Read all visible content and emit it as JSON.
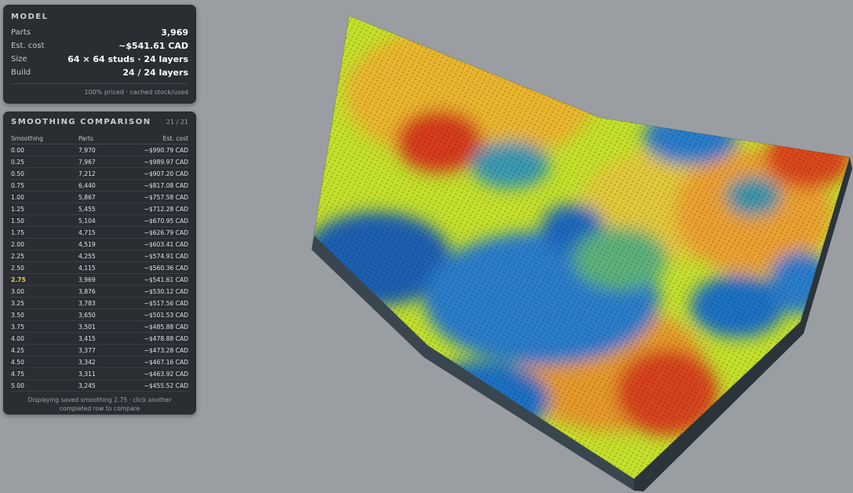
{
  "model": {
    "title": "MODEL",
    "rows": [
      {
        "label": "Parts",
        "value": "3,969"
      },
      {
        "label": "Est. cost",
        "value": "~$541.61 CAD"
      },
      {
        "label": "Size",
        "value": "64 × 64 studs · 24 layers"
      },
      {
        "label": "Build",
        "value": "24 / 24 layers"
      }
    ],
    "note": "100% priced · cached stock/used"
  },
  "smoothing": {
    "title": "SMOOTHING COMPARISON",
    "count": "21 / 21",
    "columns": [
      "Smoothing",
      "Parts",
      "Est. cost"
    ],
    "selected": "2.75",
    "rows": [
      {
        "smoothing": "0.00",
        "parts": "7,970",
        "cost": "~$990.79 CAD"
      },
      {
        "smoothing": "0.25",
        "parts": "7,967",
        "cost": "~$989.97 CAD"
      },
      {
        "smoothing": "0.50",
        "parts": "7,212",
        "cost": "~$907.20 CAD"
      },
      {
        "smoothing": "0.75",
        "parts": "6,440",
        "cost": "~$817.08 CAD"
      },
      {
        "smoothing": "1.00",
        "parts": "5,867",
        "cost": "~$757.58 CAD"
      },
      {
        "smoothing": "1.25",
        "parts": "5,455",
        "cost": "~$712.28 CAD"
      },
      {
        "smoothing": "1.50",
        "parts": "5,104",
        "cost": "~$670.95 CAD"
      },
      {
        "smoothing": "1.75",
        "parts": "4,715",
        "cost": "~$626.79 CAD"
      },
      {
        "smoothing": "2.00",
        "parts": "4,519",
        "cost": "~$603.41 CAD"
      },
      {
        "smoothing": "2.25",
        "parts": "4,255",
        "cost": "~$574.91 CAD"
      },
      {
        "smoothing": "2.50",
        "parts": "4,115",
        "cost": "~$560.36 CAD"
      },
      {
        "smoothing": "2.75",
        "parts": "3,969",
        "cost": "~$541.61 CAD"
      },
      {
        "smoothing": "3.00",
        "parts": "3,876",
        "cost": "~$530.12 CAD"
      },
      {
        "smoothing": "3.25",
        "parts": "3,783",
        "cost": "~$517.56 CAD"
      },
      {
        "smoothing": "3.50",
        "parts": "3,650",
        "cost": "~$501.53 CAD"
      },
      {
        "smoothing": "3.75",
        "parts": "3,501",
        "cost": "~$485.88 CAD"
      },
      {
        "smoothing": "4.00",
        "parts": "3,415",
        "cost": "~$478.88 CAD"
      },
      {
        "smoothing": "4.25",
        "parts": "3,377",
        "cost": "~$473.28 CAD"
      },
      {
        "smoothing": "4.50",
        "parts": "3,342",
        "cost": "~$467.16 CAD"
      },
      {
        "smoothing": "4.75",
        "parts": "3,311",
        "cost": "~$463.92 CAD"
      },
      {
        "smoothing": "5.00",
        "parts": "3,245",
        "cost": "~$455.52 CAD"
      }
    ],
    "footer": "Displaying saved smoothing 2.75 · click another completed row to compare"
  },
  "colors": {
    "background": "#9a9ea2",
    "panel": "#2a2d32",
    "selected_row": "#f2c94c",
    "terrain_side": "#2f3a42",
    "terrain_low": "#1f6fc2",
    "terrain_mid": "#b8dc2a",
    "terrain_high": "#d9321b"
  }
}
